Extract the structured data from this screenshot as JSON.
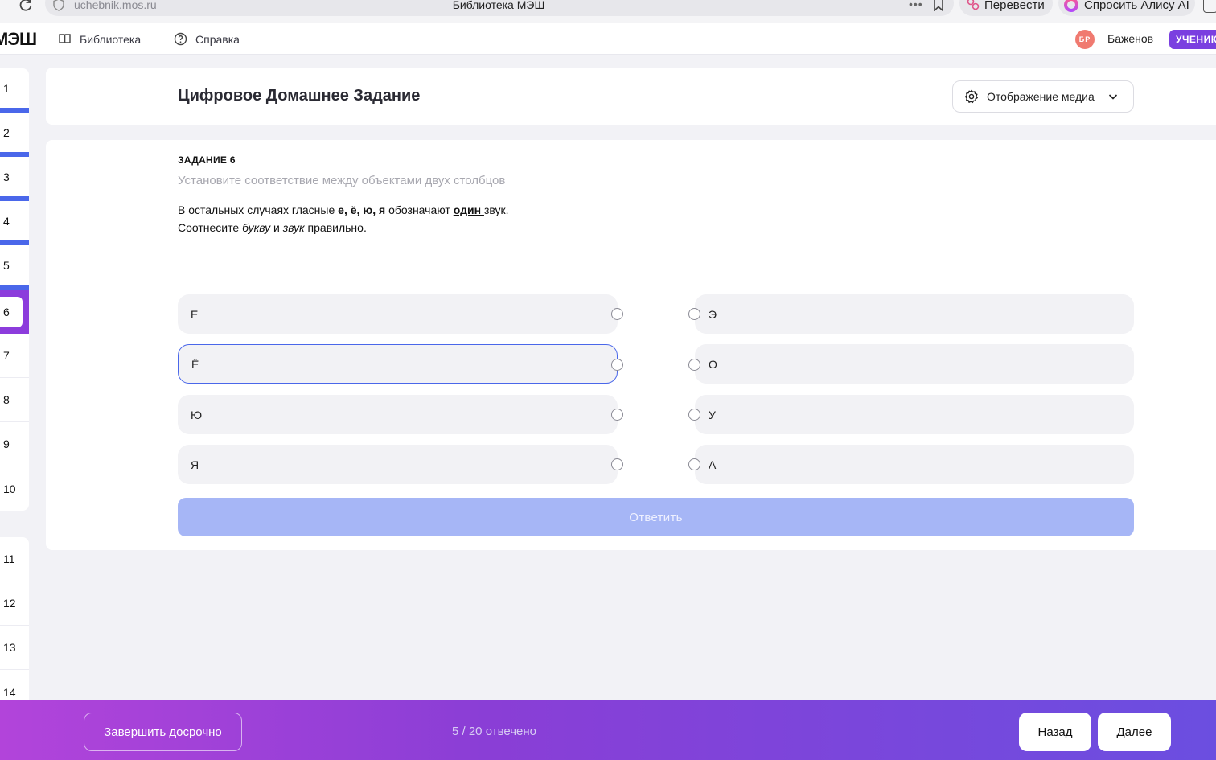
{
  "browser": {
    "url": "uchebnik.mos.ru",
    "tab_title": "Библиотека МЭШ",
    "translate_label": "Перевести",
    "alisa_label": "Спросить Алису AI"
  },
  "header": {
    "logo": "МЭШ",
    "nav": {
      "library": "Библиотека",
      "help": "Справка"
    },
    "user": {
      "initials": "БР",
      "name": "Баженов",
      "role": "УЧЕНИК"
    }
  },
  "questions": {
    "group1": [
      "1",
      "2",
      "3",
      "4",
      "5",
      "6",
      "7",
      "8",
      "9",
      "10"
    ],
    "group2": [
      "11",
      "12",
      "13",
      "14"
    ],
    "current": "6",
    "answered": [
      "1",
      "2",
      "3",
      "4",
      "5"
    ]
  },
  "page": {
    "title": "Цифровое Домашнее Задание",
    "media_button": "Отображение медиа"
  },
  "task": {
    "label": "ЗАДАНИЕ 6",
    "hint": "Установите соответствие между объектами двух столбцов",
    "line1_prefix": "В остальных случаях гласные ",
    "line1_letters": "е, ё, ю, я",
    "line1_middle": " обозначают ",
    "line1_one": "один ",
    "line1_suffix": "звук.",
    "line2_prefix": "Соотнесите ",
    "line2_letter": "букву",
    "line2_and": " и ",
    "line2_sound": "звук",
    "line2_suffix": " правильно.",
    "left_items": [
      "Е",
      "Ё",
      "Ю",
      "Я"
    ],
    "right_items": [
      "Э",
      "О",
      "У",
      "А"
    ],
    "selected_left": "Ё",
    "answer_button": "Ответить"
  },
  "footer": {
    "finish_button": "Завершить досрочно",
    "progress": "5 / 20 отвечено",
    "back_button": "Назад",
    "next_button": "Далее"
  },
  "colors": {
    "accent": "#4a67ea",
    "purple": "#8c3cdc",
    "answer_disabled": "#a6b6f6",
    "avatar": "#f07a70"
  }
}
